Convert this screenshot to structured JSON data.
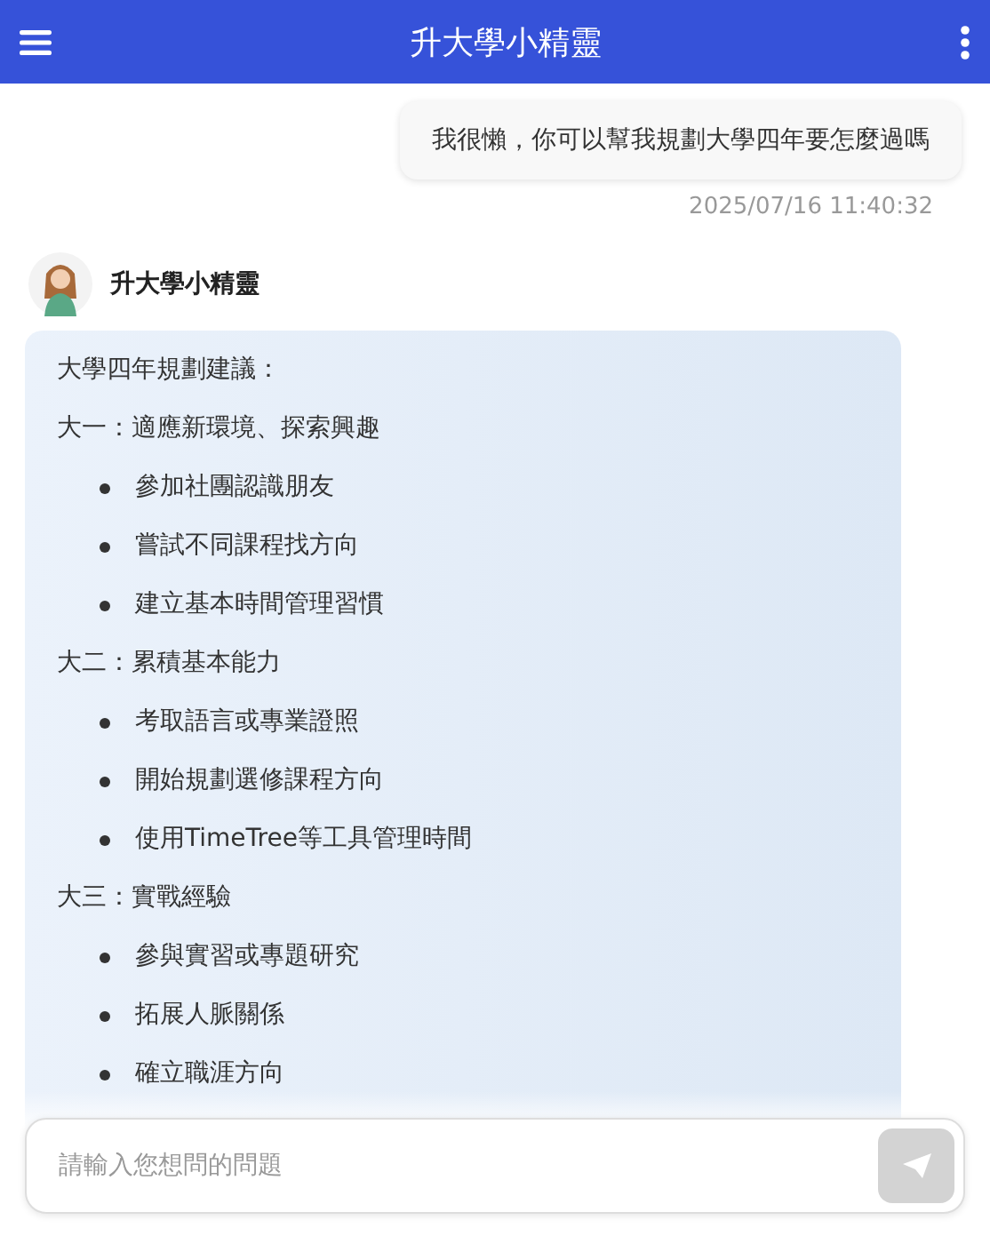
{
  "header": {
    "title": "升大學小精靈"
  },
  "messages": [
    {
      "kind": "user",
      "text": "我很懶，你可以幫我規劃大學四年要怎麼過嗎",
      "time": "2025/07/16 11:40:32"
    },
    {
      "kind": "bot",
      "sender": "升大學小精靈",
      "intro": "大學四年規劃建議：",
      "sections": [
        {
          "heading": "大一：適應新環境、探索興趣",
          "items": [
            "參加社團認識朋友",
            "嘗試不同課程找方向",
            "建立基本時間管理習慣"
          ]
        },
        {
          "heading": "大二：累積基本能力",
          "items": [
            "考取語言或專業證照",
            "開始規劃選修課程方向",
            "使用TimeTree等工具管理時間"
          ]
        },
        {
          "heading": "大三：實戰經驗",
          "items": [
            "參與實習或專題研究",
            "拓展人脈關係",
            "確立職涯方向"
          ]
        }
      ]
    }
  ],
  "input": {
    "placeholder": "請輸入您想問的問題"
  }
}
